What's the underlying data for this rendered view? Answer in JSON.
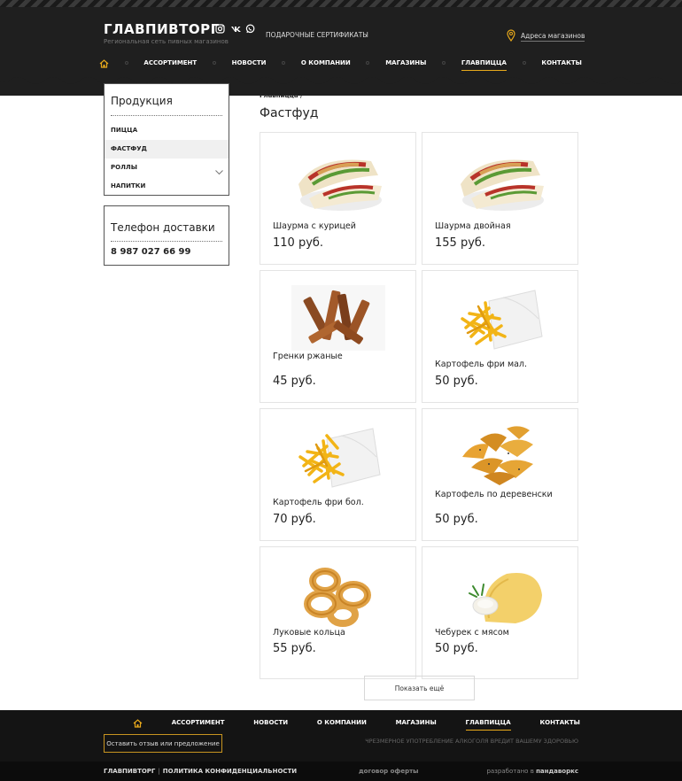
{
  "header": {
    "logo": "ГЛАВПИВТОРГ",
    "tagline": "Региональная сеть пивных магазинов",
    "social_icons": [
      "instagram-icon",
      "vk-icon",
      "whatsapp-icon"
    ],
    "gift_certificates": "ПОДАРОЧНЫЕ СЕРТИФИКАТЫ",
    "store_addresses": "Адреса магазинов",
    "accent_color": "#e8a91b"
  },
  "nav": {
    "items": [
      "АССОРТИМЕНТ",
      "НОВОСТИ",
      "О КОМПАНИИ",
      "МАГАЗИНЫ",
      "ГЛАВПИЦЦА",
      "КОНТАКТЫ"
    ],
    "active": "ГЛАВПИЦЦА"
  },
  "sidebar": {
    "title": "Продукция",
    "items": [
      {
        "label": "ПИЦЦА"
      },
      {
        "label": "ФАСТФУД",
        "active": true
      },
      {
        "label": "РОЛЛЫ",
        "has_submenu": true
      },
      {
        "label": "НАПИТКИ"
      }
    ],
    "delivery_title": "Телефон доставки",
    "delivery_phone": "8 987 027 66 99"
  },
  "breadcrumb": "Главпицца /",
  "page_title": "Фастфуд",
  "products": [
    {
      "name": "Шаурма с курицей",
      "price": "110 руб.",
      "image": "shawarma"
    },
    {
      "name": "Шаурма двойная",
      "price": "155 руб.",
      "image": "shawarma"
    },
    {
      "name": "Гренки ржаные",
      "price": "45 руб.",
      "image": "croutons"
    },
    {
      "name": "Картофель фри мал.",
      "price": "50 руб.",
      "image": "fries"
    },
    {
      "name": "Картофель фри бол.",
      "price": "70 руб.",
      "image": "fries"
    },
    {
      "name": "Картофель по деревенски",
      "price": "50 руб.",
      "image": "wedges"
    },
    {
      "name": "Луковые кольца",
      "price": "55 руб.",
      "image": "onion-rings"
    },
    {
      "name": "Чебурек с мясом",
      "price": "50 руб.",
      "image": "cheburek"
    }
  ],
  "show_more": "Показать ещё",
  "footer": {
    "nav": [
      "АССОРТИМЕНТ",
      "НОВОСТИ",
      "О КОМПАНИИ",
      "МАГАЗИНЫ",
      "ГЛАВПИЦЦА",
      "КОНТАКТЫ"
    ],
    "active": "ГЛАВПИЦЦА",
    "feedback_button": "Оставить отзыв или предложение",
    "warning": "ЧРЕЗМЕРНОЕ УПОТРЕБЛЕНИЕ АЛКОГОЛЯ ВРЕДИТ ВАШЕМУ ЗДОРОВЬЮ",
    "brand": "ГЛАВПИВТОРГ",
    "separator": "|",
    "privacy": "ПОЛИТИКА КОНФИДЕНЦИАЛЬНОСТИ",
    "offer": "договор оферты",
    "dev_prefix": "разработано в",
    "dev_name": "пандаворкс"
  }
}
